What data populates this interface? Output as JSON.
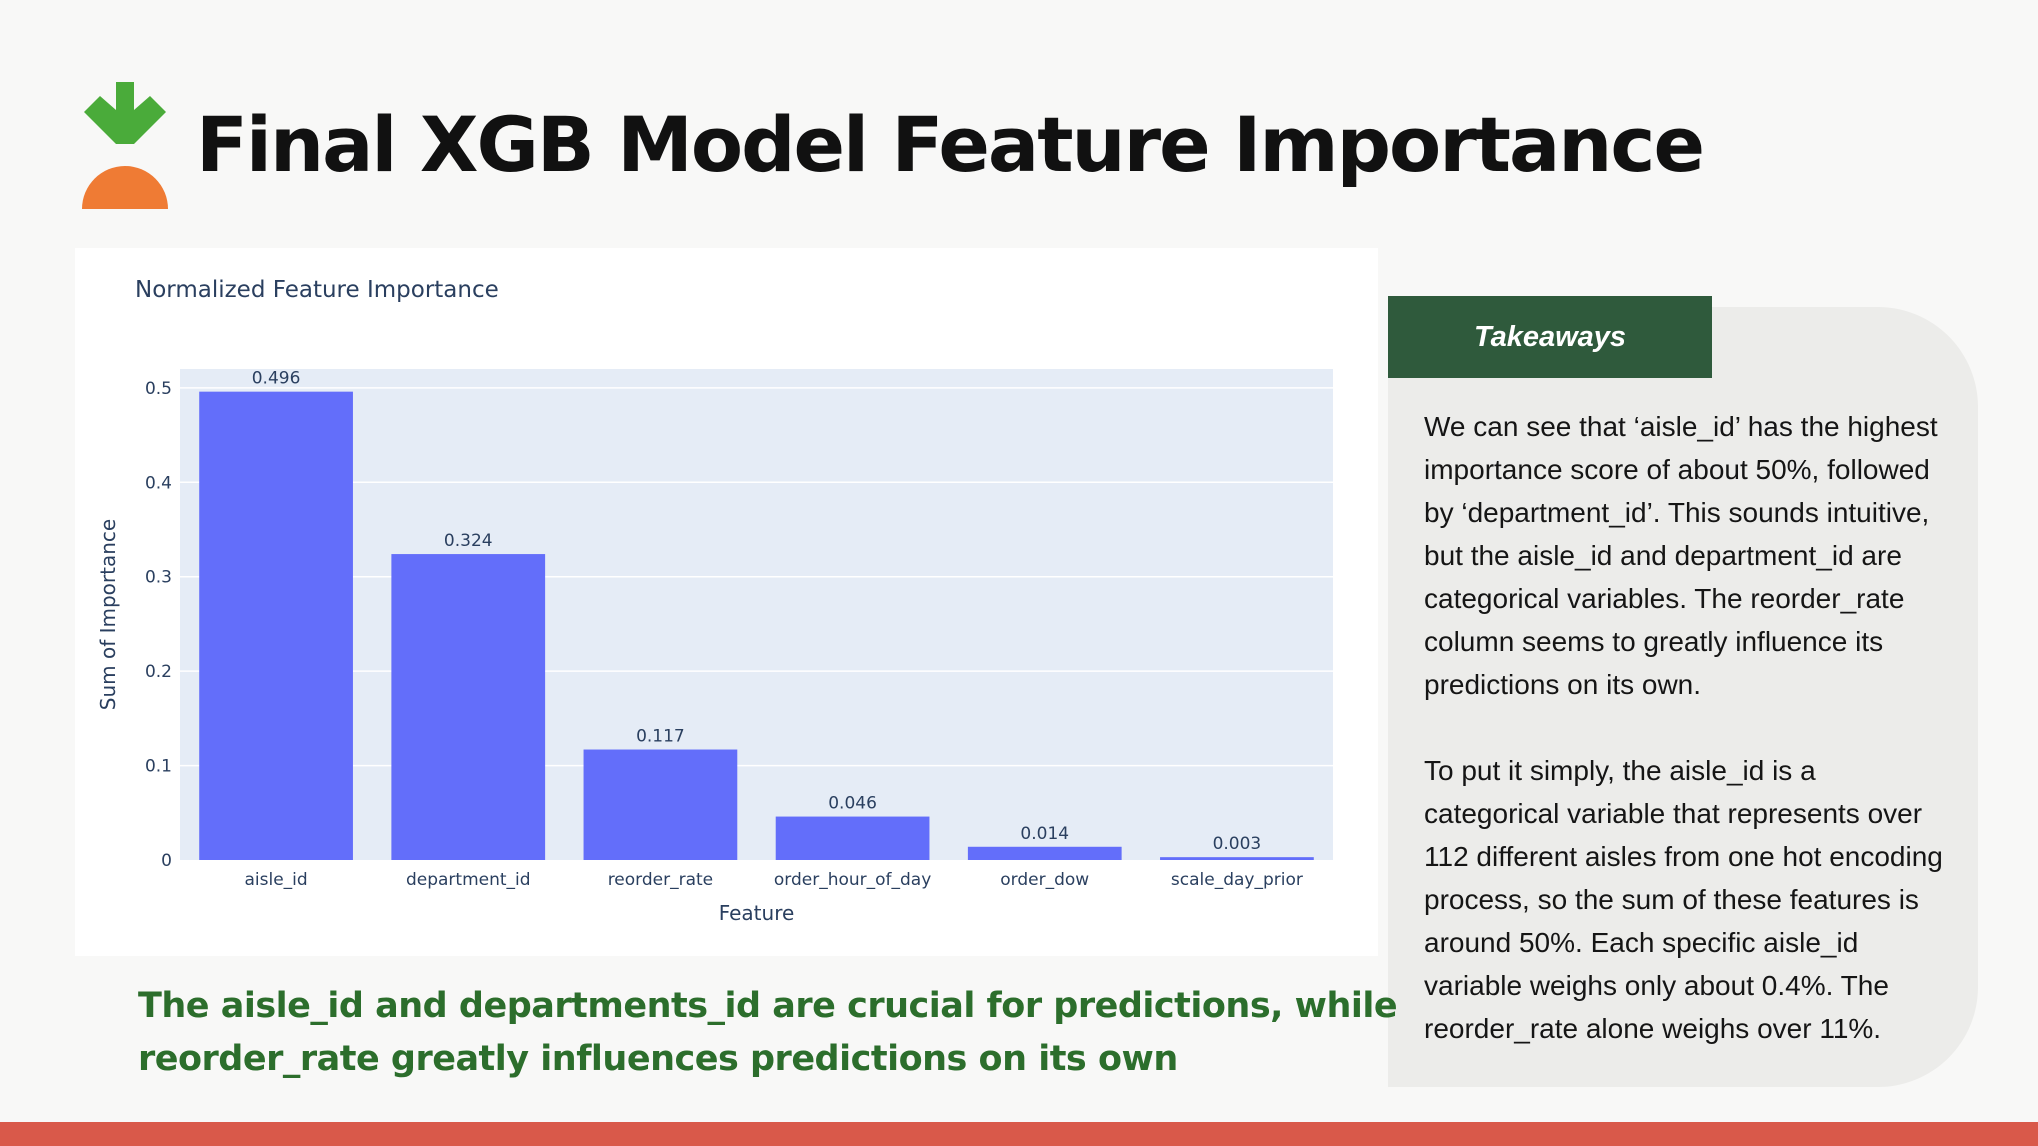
{
  "page": {
    "title": "Final XGB Model Feature Importance",
    "conclusion": "The aisle_id and departments_id are crucial for predictions, while\nreorder_rate greatly influences predictions on its own"
  },
  "takeaways": {
    "heading": "Takeaways",
    "paragraphs": [
      "We can see that ‘aisle_id’ has the highest\nimportance score of about 50%, followed\nby ‘department_id’. This sounds intuitive,\nbut the aisle_id and department_id are\ncategorical variables. The reorder_rate\ncolumn seems to greatly influence its\npredictions on its own.",
      "To put it simply, the aisle_id is a\ncategorical variable that represents over\n112 different aisles from one hot encoding\nprocess, so the sum of these features is\naround 50%. Each specific aisle_id\nvariable weighs only about 0.4%. The\nreorder_rate alone weighs over 11%."
    ]
  },
  "colors": {
    "bar": "#636efa",
    "plot_bg": "#e5ecf6",
    "takeaway_tab": "#2f5a3c",
    "conclusion_text": "#2c6e2c",
    "bottom_bar": "#d9594a",
    "logo_leaf": "#4aab3a",
    "logo_root": "#ef7b34"
  },
  "logo": {
    "icon": "carrot-logo-icon"
  },
  "chart_data": {
    "type": "bar",
    "title": "Normalized Feature Importance",
    "xlabel": "Feature",
    "ylabel": "Sum of Importance",
    "categories": [
      "aisle_id",
      "department_id",
      "reorder_rate",
      "order_hour_of_day",
      "order_dow",
      "scale_day_prior"
    ],
    "values": [
      0.496,
      0.324,
      0.117,
      0.046,
      0.014,
      0.003
    ],
    "data_labels": [
      "0.496",
      "0.324",
      "0.117",
      "0.046",
      "0.014",
      "0.003"
    ],
    "ylim": [
      0,
      0.52
    ],
    "yticks": [
      0,
      0.1,
      0.2,
      0.3,
      0.4,
      0.5
    ],
    "ytick_labels": [
      "0",
      "0.1",
      "0.2",
      "0.3",
      "0.4",
      "0.5"
    ],
    "grid": true,
    "legend": false
  }
}
